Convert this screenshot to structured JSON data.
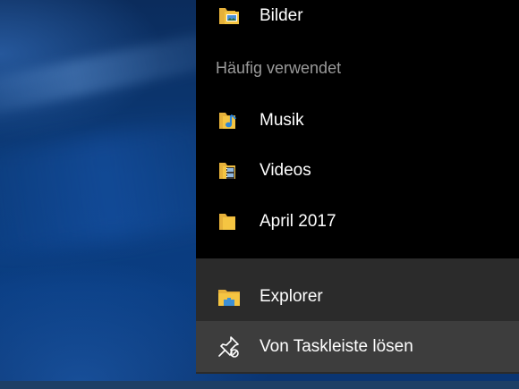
{
  "jumplist": {
    "pinned_items": [
      {
        "label": "Bilder",
        "icon": "pictures-folder-icon"
      }
    ],
    "frequent_header": "Häufig verwendet",
    "frequent_items": [
      {
        "label": "Musik",
        "icon": "music-folder-icon"
      },
      {
        "label": "Videos",
        "icon": "videos-folder-icon"
      },
      {
        "label": "April 2017",
        "icon": "folder-icon"
      }
    ],
    "actions": [
      {
        "label": "Explorer",
        "icon": "file-explorer-icon"
      },
      {
        "label": "Von Taskleiste lösen",
        "icon": "unpin-icon"
      }
    ]
  },
  "colors": {
    "menu_background": "#000000",
    "actions_background": "#2b2b2b",
    "hover_background": "#3d3d3d",
    "header_text": "#9a9a9a",
    "item_text": "#ffffff",
    "folder_yellow": "#f5c542",
    "desktop_blue": "#0b3b7a"
  }
}
